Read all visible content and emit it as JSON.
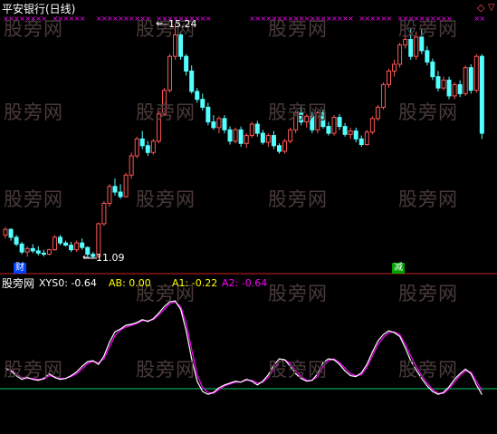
{
  "title": "平安银行(日线)",
  "watermark": "股旁网",
  "price_high_label": "15.24",
  "price_low_label": "11.09",
  "price_high_arrow": "←",
  "price_low_arrow": "←",
  "badge_cai": "财",
  "badge_jian": "减",
  "indicator": {
    "name": "股旁网",
    "items": [
      {
        "label": "XYS0: -0.64",
        "color": "#ffffff"
      },
      {
        "label": "AB: 0.00",
        "color": "#ffff00"
      },
      {
        "label": "A1: -0.22",
        "color": "#ffff00"
      },
      {
        "label": "A2: -0.64",
        "color": "#ff00ff"
      }
    ]
  },
  "colors": {
    "up": "#ff5555",
    "down": "#54ffff",
    "divider": "#cc2222",
    "signal": "#ff00ff",
    "line_white": "#ffffff",
    "line_magenta": "#ff00ff",
    "zero_line": "#00cc66",
    "badge_cai_bg": "#0040ff",
    "badge_jian_bg": "#00a000"
  },
  "candles": [
    [
      11.5,
      11.64,
      11.44,
      11.6
    ],
    [
      11.6,
      11.62,
      11.4,
      11.46
    ],
    [
      11.46,
      11.5,
      11.3,
      11.34
    ],
    [
      11.34,
      11.38,
      11.16,
      11.2
    ],
    [
      11.2,
      11.3,
      11.12,
      11.26
    ],
    [
      11.26,
      11.34,
      11.18,
      11.22
    ],
    [
      11.22,
      11.3,
      11.14,
      11.18
    ],
    [
      11.18,
      11.24,
      11.12,
      11.16
    ],
    [
      11.16,
      11.26,
      11.14,
      11.24
    ],
    [
      11.24,
      11.5,
      11.22,
      11.46
    ],
    [
      11.46,
      11.5,
      11.32,
      11.36
    ],
    [
      11.36,
      11.4,
      11.3,
      11.32
    ],
    [
      11.32,
      11.38,
      11.2,
      11.24
    ],
    [
      11.24,
      11.4,
      11.2,
      11.36
    ],
    [
      11.36,
      11.44,
      11.24,
      11.28
    ],
    [
      11.28,
      11.3,
      11.12,
      11.16
    ],
    [
      11.16,
      11.2,
      11.09,
      11.12
    ],
    [
      11.12,
      11.72,
      11.1,
      11.7
    ],
    [
      11.7,
      12.1,
      11.66,
      12.06
    ],
    [
      12.06,
      12.4,
      12.0,
      12.36
    ],
    [
      12.36,
      12.5,
      12.2,
      12.26
    ],
    [
      12.26,
      12.4,
      12.14,
      12.18
    ],
    [
      12.18,
      12.6,
      12.16,
      12.56
    ],
    [
      12.56,
      12.96,
      12.5,
      12.9
    ],
    [
      12.9,
      13.24,
      12.86,
      13.2
    ],
    [
      13.2,
      13.34,
      13.02,
      13.08
    ],
    [
      13.08,
      13.16,
      12.9,
      12.96
    ],
    [
      12.96,
      13.2,
      12.92,
      13.16
    ],
    [
      13.16,
      13.7,
      13.12,
      13.64
    ],
    [
      13.64,
      14.1,
      13.6,
      14.06
    ],
    [
      14.06,
      14.7,
      14.02,
      14.66
    ],
    [
      14.66,
      15.24,
      14.6,
      15.04
    ],
    [
      15.04,
      15.1,
      14.6,
      14.66
    ],
    [
      14.66,
      14.7,
      14.32,
      14.4
    ],
    [
      14.4,
      14.5,
      14.0,
      14.04
    ],
    [
      14.04,
      14.1,
      13.84,
      13.9
    ],
    [
      13.9,
      14.0,
      13.7,
      13.76
    ],
    [
      13.76,
      13.84,
      13.44,
      13.5
    ],
    [
      13.5,
      13.62,
      13.36,
      13.4
    ],
    [
      13.4,
      13.6,
      13.3,
      13.56
    ],
    [
      13.56,
      13.62,
      13.3,
      13.36
    ],
    [
      13.36,
      13.42,
      13.1,
      13.16
    ],
    [
      13.16,
      13.4,
      13.12,
      13.36
    ],
    [
      13.36,
      13.42,
      13.06,
      13.12
    ],
    [
      13.12,
      13.3,
      13.04,
      13.26
    ],
    [
      13.26,
      13.5,
      13.22,
      13.46
    ],
    [
      13.46,
      13.52,
      13.24,
      13.3
    ],
    [
      13.3,
      13.36,
      13.1,
      13.14
    ],
    [
      13.14,
      13.3,
      13.06,
      13.26
    ],
    [
      13.26,
      13.34,
      13.02,
      13.08
    ],
    [
      13.08,
      13.12,
      12.94,
      12.98
    ],
    [
      12.98,
      13.2,
      12.94,
      13.16
    ],
    [
      13.16,
      13.4,
      13.12,
      13.36
    ],
    [
      13.36,
      13.7,
      13.3,
      13.66
    ],
    [
      13.66,
      13.8,
      13.44,
      13.5
    ],
    [
      13.5,
      13.64,
      13.4,
      13.6
    ],
    [
      13.6,
      13.68,
      13.3,
      13.36
    ],
    [
      13.36,
      13.7,
      13.3,
      13.66
    ],
    [
      13.66,
      13.72,
      13.38,
      13.42
    ],
    [
      13.42,
      13.5,
      13.26,
      13.3
    ],
    [
      13.3,
      13.62,
      13.26,
      13.58
    ],
    [
      13.58,
      13.64,
      13.36,
      13.42
    ],
    [
      13.42,
      13.48,
      13.24,
      13.28
    ],
    [
      13.28,
      13.4,
      13.2,
      13.34
    ],
    [
      13.34,
      13.4,
      13.14,
      13.2
    ],
    [
      13.2,
      13.26,
      13.06,
      13.1
    ],
    [
      13.1,
      13.36,
      13.08,
      13.32
    ],
    [
      13.32,
      13.6,
      13.28,
      13.56
    ],
    [
      13.56,
      13.8,
      13.52,
      13.76
    ],
    [
      13.76,
      14.2,
      13.72,
      14.16
    ],
    [
      14.16,
      14.44,
      14.1,
      14.4
    ],
    [
      14.4,
      14.6,
      14.3,
      14.52
    ],
    [
      14.52,
      14.9,
      14.46,
      14.86
    ],
    [
      14.86,
      15.2,
      14.8,
      14.96
    ],
    [
      14.96,
      15.16,
      14.6,
      14.66
    ],
    [
      14.66,
      15.1,
      14.6,
      15.0
    ],
    [
      15.0,
      15.16,
      14.7,
      14.76
    ],
    [
      14.76,
      14.84,
      14.5,
      14.56
    ],
    [
      14.56,
      14.62,
      14.24,
      14.3
    ],
    [
      14.3,
      14.4,
      14.04,
      14.1
    ],
    [
      14.1,
      14.3,
      14.06,
      14.24
    ],
    [
      14.24,
      14.3,
      13.9,
      13.96
    ],
    [
      13.96,
      14.2,
      13.9,
      14.16
    ],
    [
      14.16,
      14.24,
      13.94,
      14.0
    ],
    [
      14.0,
      14.5,
      13.96,
      14.46
    ],
    [
      14.46,
      14.52,
      14.0,
      14.06
    ],
    [
      14.06,
      14.7,
      14.02,
      14.66
    ],
    [
      14.66,
      14.7,
      13.2,
      13.3
    ]
  ],
  "white_line": [
    2.2,
    1.9,
    1.4,
    1.0,
    1.2,
    1.0,
    0.9,
    1.1,
    1.6,
    1.2,
    1.0,
    1.1,
    1.4,
    1.8,
    2.4,
    2.9,
    3.0,
    2.6,
    3.5,
    5.0,
    6.1,
    6.4,
    6.8,
    6.9,
    7.1,
    7.4,
    7.2,
    7.5,
    8.1,
    8.8,
    9.3,
    9.4,
    8.5,
    6.2,
    3.2,
    0.8,
    -0.3,
    -0.6,
    -0.4,
    0.1,
    0.4,
    0.6,
    0.8,
    0.7,
    1.0,
    0.8,
    0.4,
    0.8,
    1.5,
    2.5,
    3.2,
    3.1,
    2.4,
    1.6,
    1.1,
    0.8,
    0.9,
    1.6,
    2.8,
    3.2,
    3.1,
    2.6,
    1.9,
    1.4,
    1.3,
    1.7,
    2.6,
    3.9,
    5.1,
    5.8,
    6.2,
    6.0,
    5.6,
    4.4,
    3.0,
    2.0,
    1.1,
    0.3,
    -0.3,
    -0.6,
    -0.4,
    0.2,
    1.0,
    1.6,
    2.1,
    1.6,
    0.4,
    -0.64
  ],
  "magenta_line": [
    2.0,
    2.0,
    1.6,
    1.2,
    1.1,
    1.1,
    1.0,
    1.0,
    1.4,
    1.3,
    1.1,
    1.1,
    1.3,
    1.6,
    2.1,
    2.7,
    2.9,
    2.8,
    3.2,
    4.5,
    5.7,
    6.3,
    6.6,
    6.8,
    7.0,
    7.3,
    7.3,
    7.4,
    7.9,
    8.5,
    9.1,
    9.3,
    8.8,
    7.0,
    4.2,
    1.5,
    0.1,
    -0.4,
    -0.5,
    -0.1,
    0.3,
    0.5,
    0.7,
    0.7,
    0.9,
    0.9,
    0.6,
    0.7,
    1.2,
    2.1,
    2.9,
    3.1,
    2.7,
    1.9,
    1.3,
    0.9,
    0.9,
    1.3,
    2.4,
    3.0,
    3.2,
    2.8,
    2.2,
    1.6,
    1.4,
    1.5,
    2.3,
    3.5,
    4.7,
    5.5,
    6.0,
    6.1,
    5.8,
    4.8,
    3.5,
    2.4,
    1.4,
    0.6,
    -0.1,
    -0.5,
    -0.5,
    0.0,
    0.7,
    1.4,
    1.9,
    1.8,
    0.8,
    -0.22
  ]
}
